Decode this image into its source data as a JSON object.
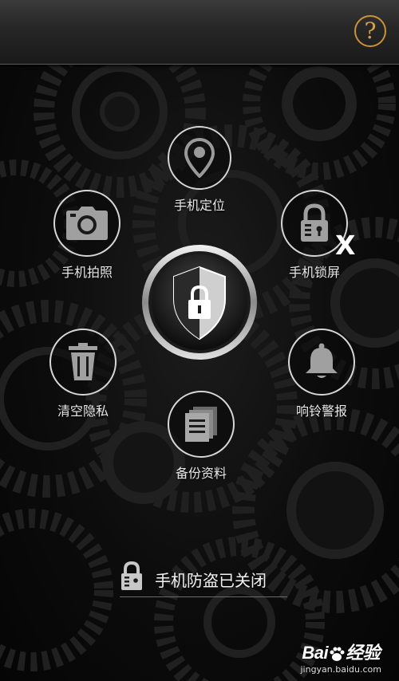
{
  "header": {
    "help_symbol": "?"
  },
  "features": {
    "locate": {
      "label": "手机定位",
      "icon": "location-pin-icon"
    },
    "photo": {
      "label": "手机拍照",
      "icon": "camera-icon"
    },
    "lock": {
      "label": "手机锁屏",
      "icon": "padlock-icon",
      "state_mark": "X"
    },
    "wipe": {
      "label": "清空隐私",
      "icon": "trash-icon"
    },
    "alarm": {
      "label": "响铃警报",
      "icon": "bell-icon"
    },
    "backup": {
      "label": "备份资料",
      "icon": "documents-icon"
    }
  },
  "center": {
    "icon": "shield-lock-icon"
  },
  "status": {
    "text": "手机防盗已关闭",
    "icon": "padlock-icon"
  },
  "watermark": {
    "logo_left": "Bai",
    "logo_right": "经验",
    "url": "jingyan.baidu.com"
  },
  "colors": {
    "accent": "#c9923c",
    "ring": "#d6d6d6",
    "label": "#e8e8e8"
  }
}
